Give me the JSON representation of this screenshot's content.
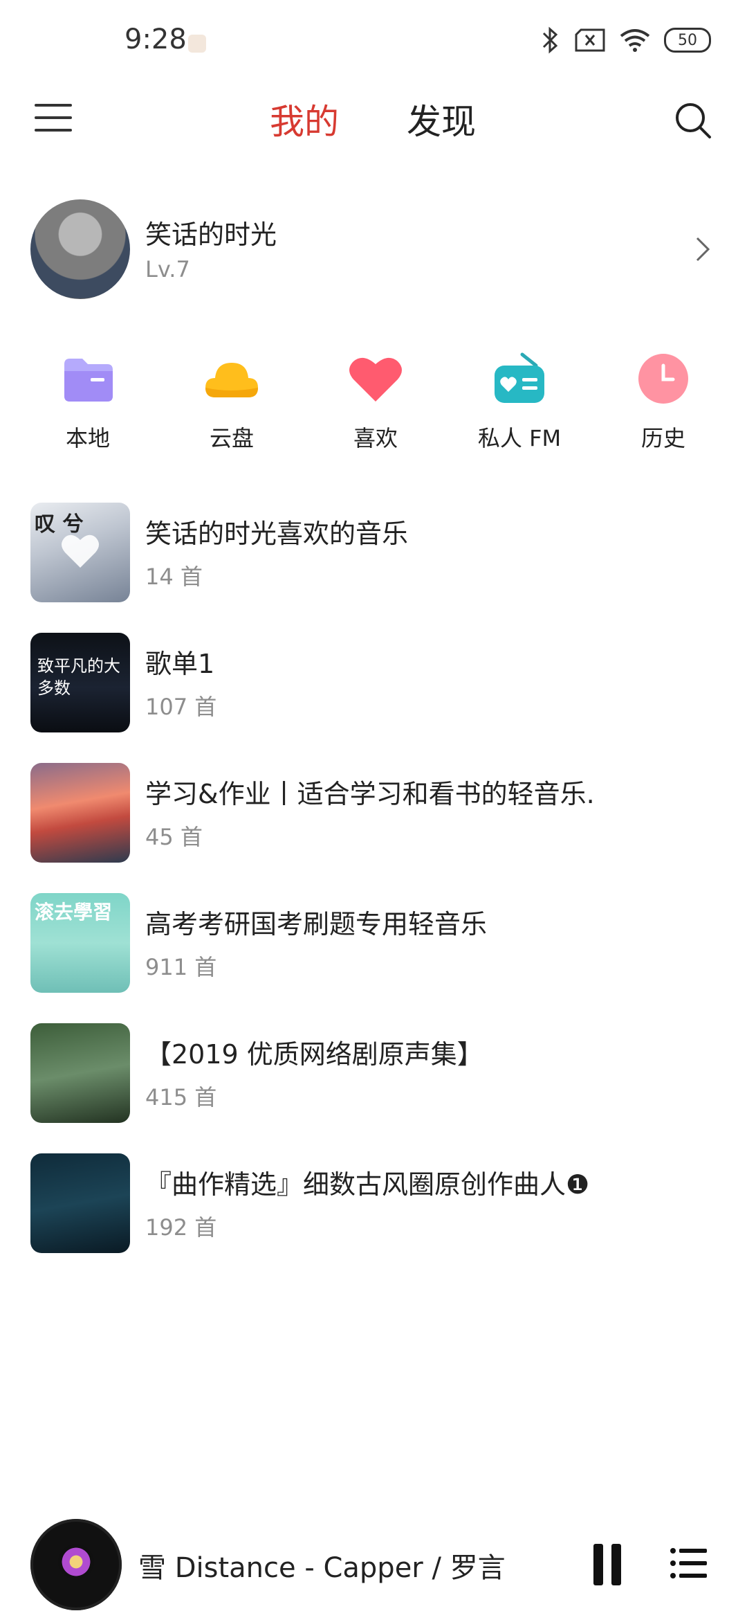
{
  "status_bar": {
    "time": "9:28",
    "battery": "50"
  },
  "nav": {
    "tab_mine": "我的",
    "tab_discover": "发现"
  },
  "profile": {
    "name": "笑话的时光",
    "level": "Lv.7"
  },
  "shortcuts": [
    {
      "label": "本地",
      "icon": "folder-icon",
      "color": "#a8a3ff"
    },
    {
      "label": "云盘",
      "icon": "cloud-icon",
      "color": "#ffbf1f"
    },
    {
      "label": "喜欢",
      "icon": "heart-icon",
      "color": "#ff5a6e"
    },
    {
      "label": "私人 FM",
      "icon": "radio-icon",
      "color": "#2ec4c4"
    },
    {
      "label": "历史",
      "icon": "clock-icon",
      "color": "#ff8fa0"
    }
  ],
  "playlists": [
    {
      "title": "笑话的时光喜欢的音乐",
      "count": "14 首",
      "cover_text": "叹 兮"
    },
    {
      "title": "歌单1",
      "count": "107 首",
      "cover_text": "致平凡的大多数"
    },
    {
      "title": "学习&作业丨适合学习和看书的轻音乐.",
      "count": "45 首"
    },
    {
      "title": "高考考研国考刷题专用轻音乐",
      "count": "911 首",
      "cover_text": "滚去學習"
    },
    {
      "title": "【2019 优质网络剧原声集】",
      "count": "415 首"
    },
    {
      "title": "『曲作精选』细数古风圈原创作曲人❶",
      "count": "192 首"
    }
  ],
  "player": {
    "song": "雪 Distance - Capper / 罗言"
  },
  "colors": {
    "accent": "#d73a31",
    "muted_text": "#8d8d8d"
  }
}
